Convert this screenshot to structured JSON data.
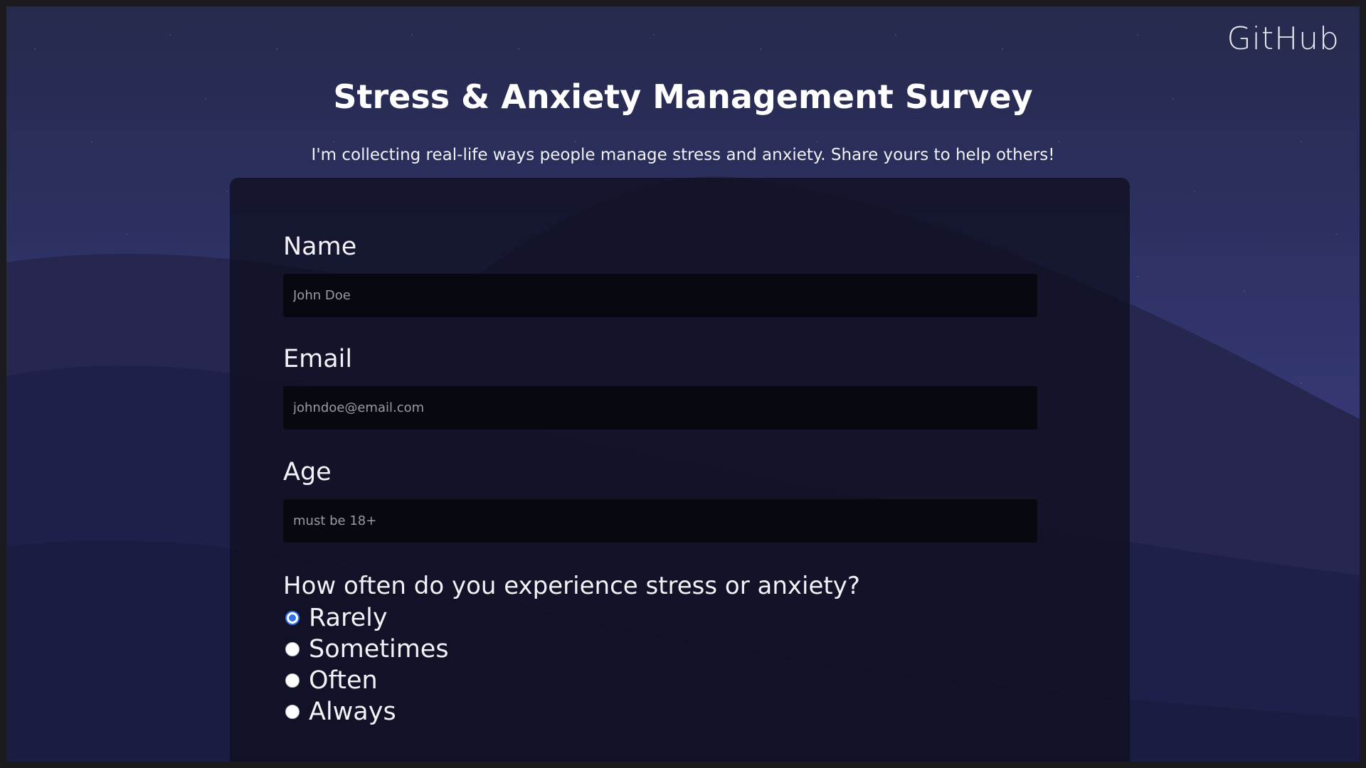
{
  "header": {
    "github_link": "GitHub",
    "title": "Stress & Anxiety Management Survey",
    "description": "I'm collecting real-life ways people manage stress and anxiety. Share yours to help others!"
  },
  "form": {
    "name_label": "Name",
    "name_placeholder": "John Doe",
    "email_label": "Email",
    "email_placeholder": "johndoe@email.com",
    "age_label": "Age",
    "age_placeholder": "must be 18+",
    "frequency_question": "How often do you experience stress or anxiety?",
    "frequency_options": [
      {
        "label": "Rarely",
        "selected": true
      },
      {
        "label": "Sometimes",
        "selected": false
      },
      {
        "label": "Often",
        "selected": false
      },
      {
        "label": "Always",
        "selected": false
      }
    ]
  },
  "colors": {
    "accent": "#2f73e6",
    "sky": "#2c3060",
    "card": "#0e0e1e"
  }
}
